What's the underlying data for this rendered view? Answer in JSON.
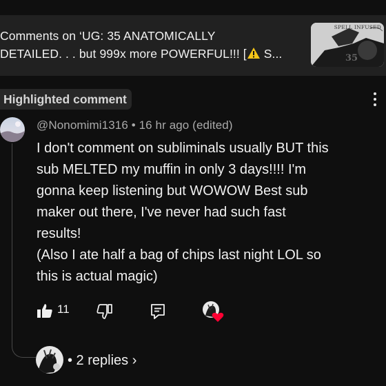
{
  "video": {
    "title": "Comments on ‘UG: 35 ANATOMICALLY\nDETAILED. . . but 999x more POWERFUL!!! [",
    "title_end": " S...",
    "warning_icon": "warning-icon",
    "thumbnail_text": "SPELL INFUSED",
    "thumbnail_number": "35"
  },
  "comment": {
    "badge": "Highlighted comment",
    "author": "@Nonomimi1316",
    "separator": "•",
    "time": "16 hr ago (edited)",
    "text": "I don't comment on subliminals usually BUT this\nsub MELTED my muffin in only 3 days!!!! I'm\ngonna keep listening but WOWOW Best sub\nmaker out there, I've never had such fast\nresults!\n(Also I ate half a bag of chips last night LOL so\nthis is actual magic)",
    "like_count": "11",
    "icons": {
      "like": "thumbs-up-icon",
      "dislike": "thumbs-down-icon",
      "reply": "reply-icon",
      "more": "more-vert-icon",
      "creator_heart": "creator-heart-icon"
    },
    "replies_label": "• 2 replies ›"
  },
  "colors": {
    "background": "#0f0f0f",
    "header_background": "#212121",
    "badge_background": "#272727",
    "meta_text": "#aaaaaa",
    "heart": "#ff0033"
  }
}
